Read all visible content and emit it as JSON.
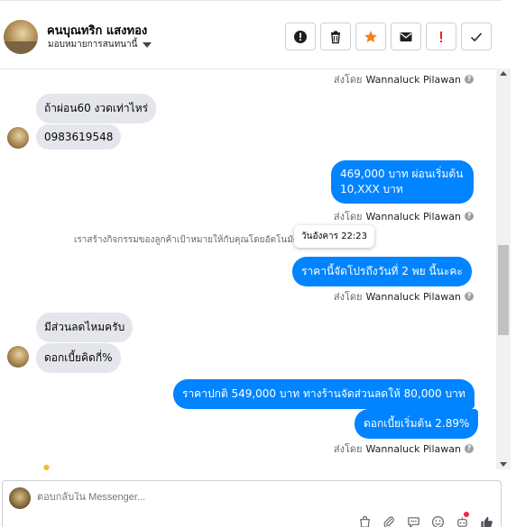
{
  "header": {
    "contact_name": "คนบุณทริก แสงทอง",
    "assign_label": "มอบหมายการสนทนานี้",
    "actions": [
      {
        "icon": "alert-icon",
        "name": "action-mark-spam"
      },
      {
        "icon": "trash-icon",
        "name": "action-delete"
      },
      {
        "icon": "star-icon",
        "name": "action-star"
      },
      {
        "icon": "envelope-icon",
        "name": "action-mark-unread"
      },
      {
        "icon": "exclamation-icon",
        "name": "action-follow-up"
      },
      {
        "icon": "check-icon",
        "name": "action-mark-done"
      }
    ]
  },
  "thread": {
    "sent_by_prefix": "ส่งโดย",
    "agent_name": "Wannaluck Pilawan",
    "messages": {
      "in_1": "ถ้าผ่อน60 งวดเท่าไหร่",
      "in_2": "0983619548",
      "out_1_line1": "469,000 บาท  ผ่อนเริ่มต้น",
      "out_1_line2": "10,XXX   บาท",
      "system_note": "เราสร้างกิจกรรมของลูกค้าเป้าหมายให้กับคุณโดยอัตโนมัติตามการสนทนานี้",
      "tooltip": "วันอังคาร 22:23",
      "out_2": "ราคานี้จัดโปรถึงวันที่ 2 พย   นี้นะคะ",
      "in_3": "มีส่วนลดไหมครับ",
      "in_4": "ดอกเบี้ยคิดกี่%",
      "out_3": "ราคาปกติ 549,000 บาท   ทางร้านจัดส่วนลดให้  80,000 บาท",
      "out_4": "ดอกเบี้ยเริ่มต้น 2.89%"
    }
  },
  "composer": {
    "placeholder": "ตอบกลับใน Messenger..."
  },
  "colors": {
    "outgoing_bubble": "#0084ff",
    "incoming_bubble": "#e4e6eb",
    "star_accent": "#f5821f",
    "alert_accent": "#e4262c"
  }
}
